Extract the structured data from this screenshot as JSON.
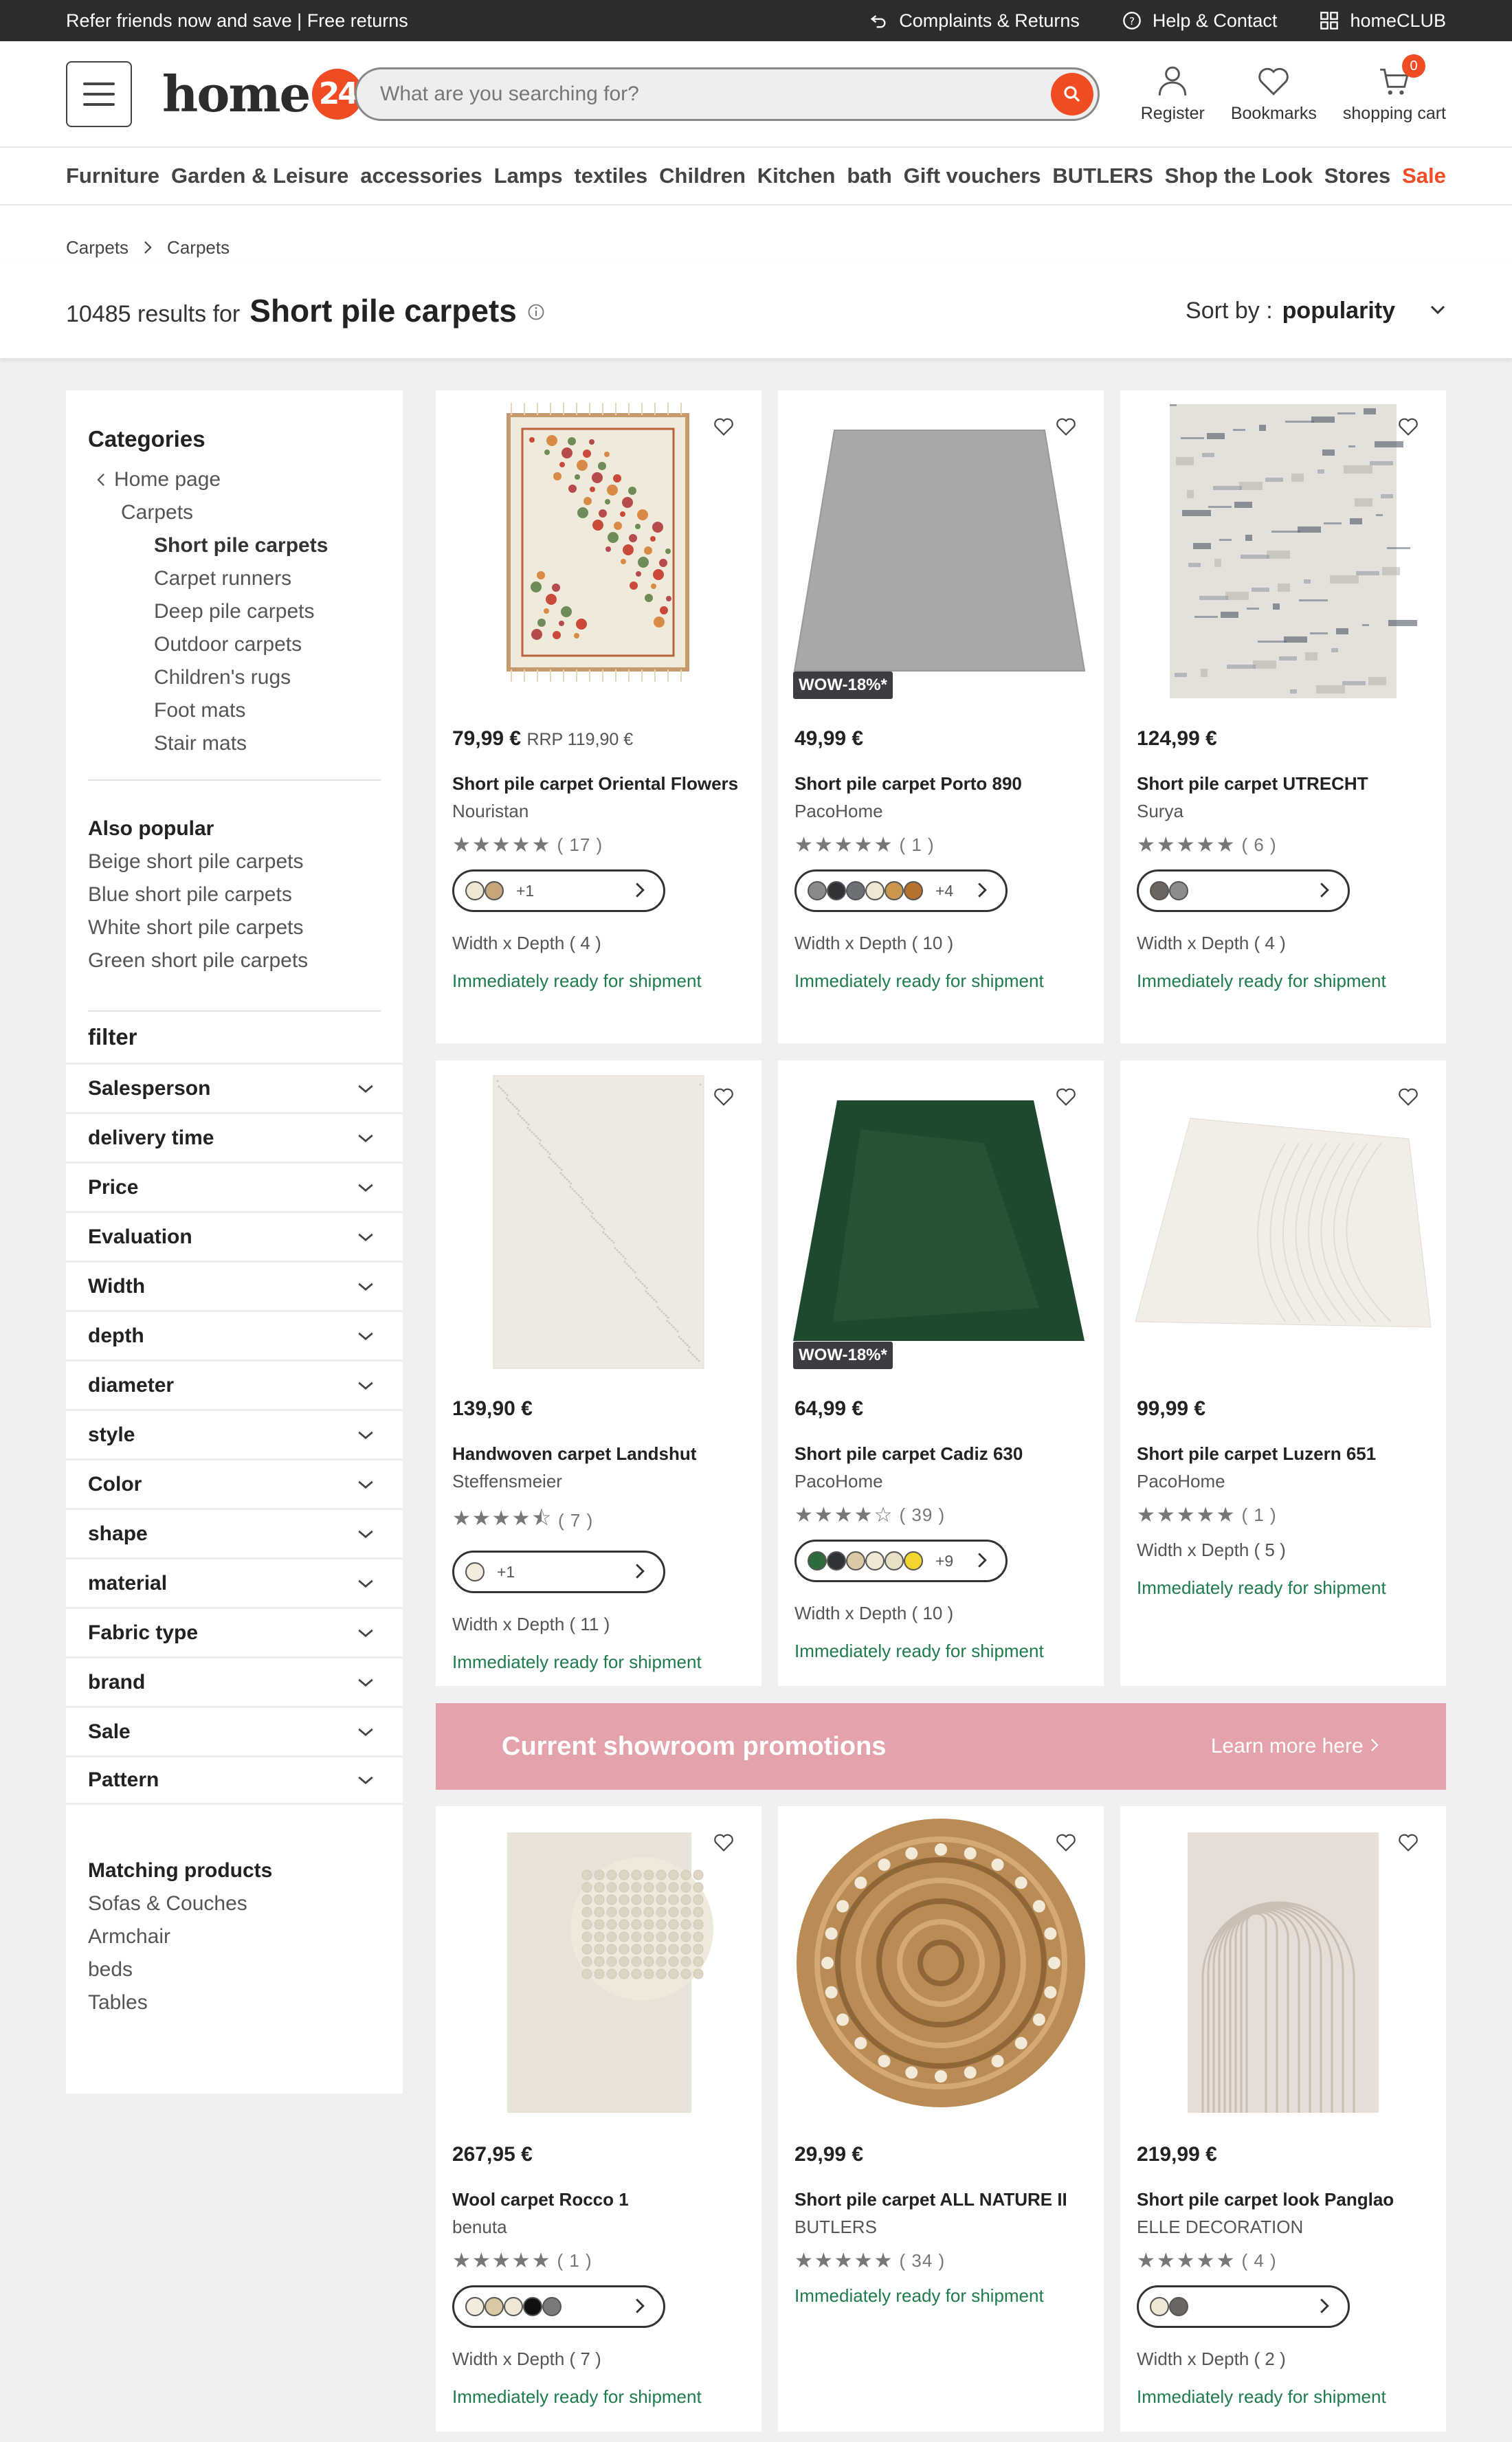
{
  "topbar": {
    "promo": "Refer friends now and save | Free returns",
    "complaints": "Complaints & Returns",
    "help": "Help & Contact",
    "club": "homeCLUB"
  },
  "header": {
    "logo_text": "home",
    "logo_num": "24",
    "search_placeholder": "What are you searching for?",
    "register": "Register",
    "bookmarks": "Bookmarks",
    "cart": "shopping cart",
    "cart_count": "0"
  },
  "nav": [
    "Furniture",
    "Garden & Leisure",
    "accessories",
    "Lamps",
    "textiles",
    "Children",
    "Kitchen",
    "bath",
    "Gift vouchers",
    "BUTLERS",
    "Shop the Look",
    "Stores",
    "Sale"
  ],
  "breadcrumb": [
    "Carpets",
    "Carpets"
  ],
  "results": {
    "count": "10485 results for",
    "query": "Short pile carpets",
    "sort_label": "Sort by :",
    "sort_value": "popularity"
  },
  "sidebar": {
    "categories_title": "Categories",
    "home": "Home page",
    "parent": "Carpets",
    "current": "Short pile carpets",
    "siblings": [
      "Carpet runners",
      "Deep pile carpets",
      "Outdoor carpets",
      "Children's rugs",
      "Foot mats",
      "Stair mats"
    ],
    "popular_title": "Also popular",
    "popular": [
      "Beige short pile carpets",
      "Blue short pile carpets",
      "White short pile carpets",
      "Green short pile carpets"
    ],
    "filter_title": "filter",
    "filters": [
      "Salesperson",
      "delivery time",
      "Price",
      "Evaluation",
      "Width",
      "depth",
      "diameter",
      "style",
      "Color",
      "shape",
      "material",
      "Fabric type",
      "brand",
      "Sale",
      "Pattern"
    ],
    "matching_title": "Matching products",
    "matching": [
      "Sofas & Couches",
      "Armchair",
      "beds",
      "Tables"
    ]
  },
  "products": [
    {
      "price": "79,99 €",
      "rrp": "RRP 119,90 €",
      "name": "Short pile carpet Oriental Flowers",
      "brand": "Nouristan",
      "rating": 5,
      "reviews": "( 17 )",
      "swatches": [
        "#efe6d3",
        "#c8a57a"
      ],
      "more": "+1",
      "dims": "Width x Depth ( 4 )",
      "ship": "Immediately ready for shipment",
      "badge": ""
    },
    {
      "price": "49,99 €",
      "rrp": "",
      "name": "Short pile carpet Porto 890",
      "brand": "PacoHome",
      "rating": 5,
      "reviews": "( 1 )",
      "swatches": [
        "#8a8a8a",
        "#2f3237",
        "#6c7075",
        "#efe6d3",
        "#c99750",
        "#b8702e"
      ],
      "more": "+4",
      "dims": "Width x Depth ( 10 )",
      "ship": "Immediately ready for shipment",
      "badge": "WOW-18%*"
    },
    {
      "price": "124,99 €",
      "rrp": "",
      "name": "Short pile carpet UTRECHT",
      "brand": "Surya",
      "rating": 5,
      "reviews": "( 6 )",
      "swatches": [
        "#6b6561",
        "#8a8c8e"
      ],
      "more": "",
      "dims": "Width x Depth ( 4 )",
      "ship": "Immediately ready for shipment",
      "badge": ""
    },
    {
      "price": "139,90 €",
      "rrp": "",
      "name": "Handwoven carpet Landshut",
      "brand": "Steffensmeier",
      "rating": 4.5,
      "reviews": "( 7 )",
      "swatches": [
        "#f3ecdc"
      ],
      "more": "+1",
      "dims": "Width x Depth ( 11 )",
      "ship": "Immediately ready for shipment",
      "badge": ""
    },
    {
      "price": "64,99 €",
      "rrp": "",
      "name": "Short pile carpet Cadiz 630",
      "brand": "PacoHome",
      "rating": 4,
      "reviews": "( 39 )",
      "swatches": [
        "#2e6b3c",
        "#2f3237",
        "#d8c8a4",
        "#efe6d3",
        "#e8e0c6",
        "#f0d62e"
      ],
      "more": "+9",
      "dims": "Width x Depth ( 10 )",
      "ship": "Immediately ready for shipment",
      "badge": "WOW-18%*"
    },
    {
      "price": "99,99 €",
      "rrp": "",
      "name": "Short pile carpet Luzern 651",
      "brand": "PacoHome",
      "rating": 5,
      "reviews": "( 1 )",
      "swatches": [],
      "more": "",
      "dims": "Width x Depth ( 5 )",
      "ship": "Immediately ready for shipment",
      "badge": ""
    },
    {
      "price": "267,95 €",
      "rrp": "",
      "name": "Wool carpet Rocco 1",
      "brand": "benuta",
      "rating": 5,
      "reviews": "( 1 )",
      "swatches": [
        "#f3ecdc",
        "#d8c8a4",
        "#efe6d3",
        "#111111",
        "#7a7a7a"
      ],
      "more": "",
      "dims": "Width x Depth ( 7 )",
      "ship": "Immediately ready for shipment",
      "badge": ""
    },
    {
      "price": "29,99 €",
      "rrp": "",
      "name": "Short pile carpet ALL NATURE II",
      "brand": "BUTLERS",
      "rating": 5,
      "reviews": "( 34 )",
      "swatches": [],
      "more": "",
      "dims": "",
      "ship": "Immediately ready for shipment",
      "badge": ""
    },
    {
      "price": "219,99 €",
      "rrp": "",
      "name": "Short pile carpet look Panglao",
      "brand": "ELLE DECORATION",
      "rating": 5,
      "reviews": "( 4 )",
      "swatches": [
        "#efe6d3",
        "#6b6561"
      ],
      "more": "",
      "dims": "Width x Depth ( 2 )",
      "ship": "Immediately ready for shipment",
      "badge": ""
    }
  ],
  "promo": {
    "title": "Current showroom promotions",
    "link": "Learn more here"
  },
  "colors": {
    "accent": "#f04b23",
    "ship": "#1e7b4c",
    "promo": "#e4a3aa"
  }
}
